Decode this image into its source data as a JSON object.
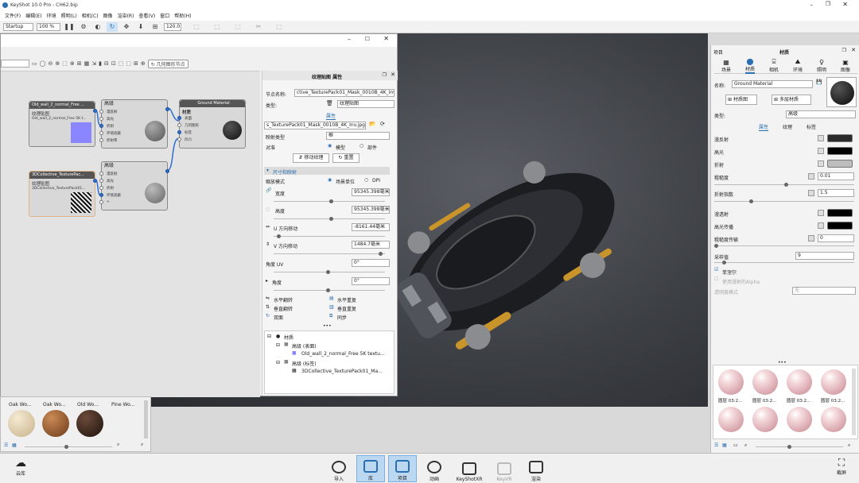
{
  "window_title": "KeyShot 10.0 Pro  - CH62.bip",
  "menu": [
    "文件(F)",
    "编辑(E)",
    "环境",
    "照明(L)",
    "相机(C)",
    "图像",
    "渲染(R)",
    "查看(V)",
    "窗口",
    "帮助(H)"
  ],
  "toolbar": {
    "preset": "Startup",
    "zoom": "100 %",
    "fov": "120.0"
  },
  "material_graph": {
    "toolbar_label": "几何图形节点",
    "nodes": {
      "tex1": {
        "title": "Old_wall_2_normal_Free ...",
        "sub": "纹理贴图",
        "file": "Old_wall_2_normal_Free 5K t..."
      },
      "tex2": {
        "title": "3DCollective_TexturePac...",
        "sub": "纹理贴图",
        "file": "3DCollective_TexturePack01..."
      },
      "adv1": {
        "title": "高级",
        "ports": [
          "漫反射",
          "高光",
          "折射",
          "环境遮蔽",
          "折射率"
        ]
      },
      "adv2": {
        "title": "高级",
        "ports": [
          "漫反射",
          "高光",
          "折射",
          "环境遮蔽",
          "+"
        ]
      },
      "mat": {
        "title": "Ground Material",
        "sub": "材质",
        "ports": [
          "表面",
          "几何图形",
          "标签",
          "凹凸"
        ]
      }
    }
  },
  "texture_panel": {
    "title": "纹理贴图 属性",
    "node_name_label": "节点名称:",
    "node_name": "ctive_TexturePack01_Mask_0010B_4K_Inv",
    "type_label": "类型:",
    "type_value": "纹理贴图",
    "tab_props": "属性",
    "file": "s_TexturePack01_Mask_0010B_4K_Inv.jpg",
    "mapping_label": "映射类型",
    "mapping_value": "框",
    "align_label": "对准",
    "radio_model": "模型",
    "radio_part": "部件",
    "btn_move": "移动纹理",
    "btn_reset": "重置",
    "section_size": "尺寸和映射",
    "scale_mode_label": "缩放模式",
    "scale_scene": "场景单位",
    "scale_dpi": "DPI",
    "width_label": "宽度",
    "width_value": "95345.398毫米",
    "height_label": "高度",
    "height_value": "95345.398毫米",
    "u_shift_label": "U 方向移动",
    "u_shift_value": "-8161.44毫米",
    "v_shift_label": "V 方向移动",
    "v_shift_value": "1484.7毫米",
    "angle_uv_label": "角度 UV",
    "angle_uv_value": "0°",
    "angle_label": "角度",
    "angle_value": "0°",
    "flip_h": "水平翻转",
    "repeat_h": "水平重复",
    "flip_v": "垂直翻转",
    "repeat_v": "垂直重复",
    "both_sides": "双面",
    "sync": "同步"
  },
  "tree": [
    "材质",
    "高级 (表面)",
    "Old_wall_2_normal_Free 5K textu...",
    "高级 (标签)",
    "3DCollective_TexturePack01_Ma..."
  ],
  "library": {
    "items": [
      "Oak Wo...",
      "Oak Wo...",
      "Old Wo...",
      "Pine Wo..."
    ]
  },
  "right_panel": {
    "tab_project": "项目",
    "tab_material": "材质",
    "sub_tabs": [
      "场景",
      "材质",
      "相机",
      "环境",
      "照明",
      "图像"
    ],
    "name_label": "名称:",
    "name_value": "Ground Material",
    "btn_graph": "材质图",
    "btn_multi": "多层材质",
    "type_label": "类型:",
    "type_value": "高级",
    "prop_tabs": [
      "属性",
      "纹理",
      "标签"
    ],
    "diffuse": "漫反射",
    "specular": "高光",
    "refraction": "折射",
    "roughness": "粗糙度",
    "roughness_value": "0.01",
    "ior": "折射指数",
    "ior_value": "1.5",
    "translucency": "漫透射",
    "spec_trans": "高光传播",
    "rough_trans": "粗糙度传输",
    "rough_trans_value": "0",
    "samples": "采样值",
    "samples_value": "9",
    "fresnel": "菲涅尔",
    "use_alpha": "使用漫射的Alpha",
    "transparency_mode": "透明度模式",
    "transparency_value": "无",
    "material_balls": [
      "圆层 03:2...",
      "圆层 03:2...",
      "圆层 03:2...",
      "圆层 03:2..."
    ]
  },
  "bottom": {
    "cloud": "云库",
    "items": [
      "导入",
      "库",
      "项目",
      "动画",
      "KeyShotXR",
      "KeyVR",
      "渲染"
    ],
    "screenshot": "截屏"
  }
}
